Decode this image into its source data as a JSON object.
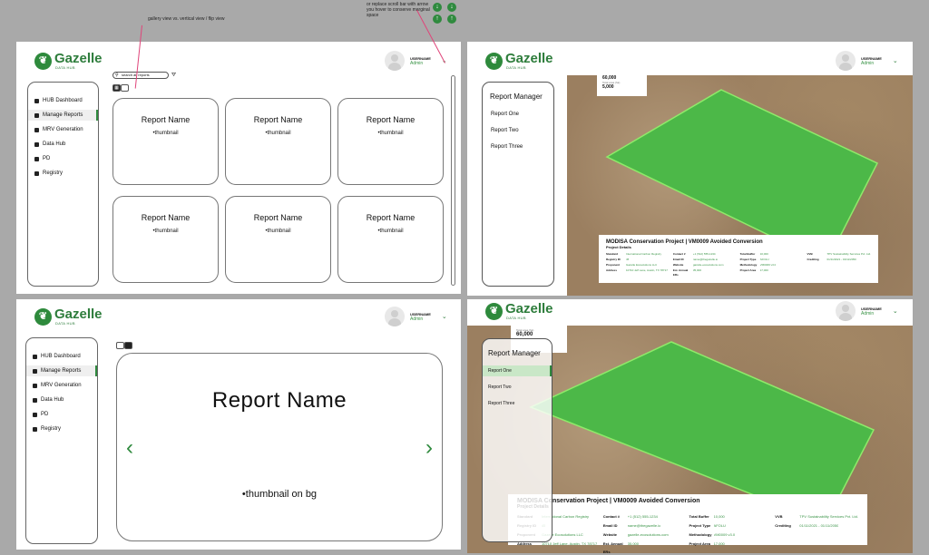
{
  "notes": {
    "view_note": "gallery view vs. vertical view / flip view",
    "scroll_note": "or replace scroll bar with arrow you hover to conserve marginal space"
  },
  "brand": {
    "name": "Gazelle",
    "sub": "DATA HUB"
  },
  "user": {
    "name": "USERNAME",
    "role": "Admin"
  },
  "nav": [
    "HUB Dashboard",
    "Manage Reports",
    "MRV Generation",
    "Data Hub",
    "PD",
    "Registry"
  ],
  "search": {
    "placeholder": "search all reports"
  },
  "cards": [
    {
      "name": "Report Name",
      "thumb": "•thumbnail"
    },
    {
      "name": "Report Name",
      "thumb": "•thumbnail"
    },
    {
      "name": "Report Name",
      "thumb": "•thumbnail"
    },
    {
      "name": "Report Name",
      "thumb": "•thumbnail"
    },
    {
      "name": "Report Name",
      "thumb": "•thumbnail"
    },
    {
      "name": "Report Name",
      "thumb": "•thumbnail"
    }
  ],
  "flip": {
    "name": "Report Name",
    "thumb": "•thumbnail on bg"
  },
  "report_manager": {
    "title": "Report Manager",
    "items": [
      "Report One",
      "Report Two",
      "Report Three"
    ]
  },
  "stats": [
    {
      "value": "60,000",
      "label": "Total area (ha)"
    },
    {
      "value": "5,000",
      "label": "Annual credits"
    }
  ],
  "stats_p4": {
    "value": "60,000",
    "label": "Total area (ha)"
  },
  "project": {
    "title": "MODISA Conservation Project | VM0009 Avoided Conversion",
    "subtitle": "Project Details",
    "fields": [
      {
        "label": "Standard",
        "value": "International Carbon Registry"
      },
      {
        "label": "Contact #",
        "value": "+1 (512) 555-1234"
      },
      {
        "label": "Total Buffer",
        "value": "10,000"
      },
      {
        "label": "VVB",
        "value": "TPV Sustainability Services Pvt. Ltd."
      },
      {
        "label": "Registry ID",
        "value": "45"
      },
      {
        "label": "Email ID",
        "value": "name@thegazelle.io"
      },
      {
        "label": "Project Type",
        "value": "AFOLU"
      },
      {
        "label": "Crediting",
        "value": "01/11/2021 - 01/11/2050"
      },
      {
        "label": "Proponent",
        "value": "Gazelle Ecosolutions LLC"
      },
      {
        "label": "Website",
        "value": "gazelle-ecosolutions.com"
      },
      {
        "label": "Methodology",
        "value": "VM0009 v3.0"
      },
      {
        "label": "",
        "value": ""
      },
      {
        "label": "Address",
        "value": "10710 Jeff Lane, Austin, TX 78717"
      },
      {
        "label": "Est. Annual ERs",
        "value": "35,000"
      },
      {
        "label": "Project Area",
        "value": "17,000"
      },
      {
        "label": "",
        "value": ""
      }
    ]
  },
  "icons": [
    "leaf-logo-icon",
    "chevron-down-icon",
    "search-icon",
    "filter-icon",
    "grid-view-icon",
    "list-view-icon",
    "chevron-left-icon",
    "chevron-right-icon",
    "arrow-down-icon",
    "arrow-up-icon"
  ],
  "colors": {
    "brand_green": "#2e7d3c",
    "polygon_green": "#4cb848",
    "accent_pink": "#e0457a"
  }
}
